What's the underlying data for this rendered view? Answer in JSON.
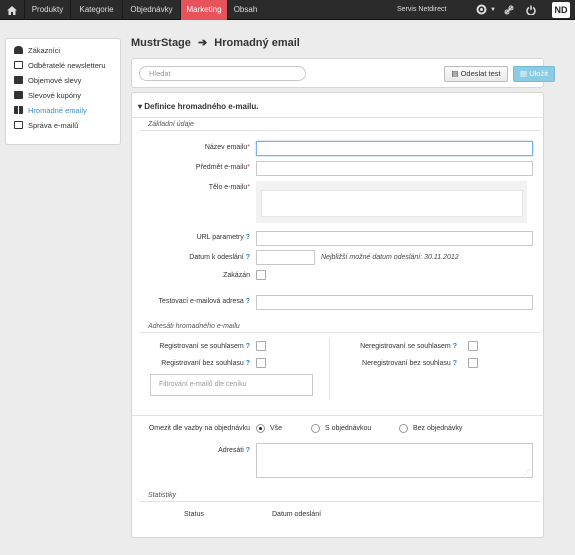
{
  "topbar": {
    "home_icon": "home-icon",
    "nav": [
      {
        "label": "Produkty"
      },
      {
        "label": "Kategorie"
      },
      {
        "label": "Objednávky"
      },
      {
        "label": "Marketing",
        "active": true
      },
      {
        "label": "Obsah"
      }
    ],
    "user": "Servis Netdirect",
    "icons": [
      "gear-icon",
      "link-icon",
      "power-icon"
    ],
    "logo": "ND"
  },
  "sidebar": {
    "items": [
      {
        "label": "Zákazníci",
        "icon": "user-icon"
      },
      {
        "label": "Odběratelé newsletteru",
        "icon": "envelope-icon"
      },
      {
        "label": "Objemové slevy",
        "icon": "folder-icon"
      },
      {
        "label": "Slevové kupóny",
        "icon": "folder-icon"
      },
      {
        "label": "Hromadné emaily",
        "icon": "grid-icon",
        "active": true
      },
      {
        "label": "Správa e-mailů",
        "icon": "envelope-icon"
      }
    ]
  },
  "page": {
    "breadcrumb_root": "MustrStage",
    "arrow": "➔",
    "title": "Hromadný email"
  },
  "toolbar": {
    "search_placeholder": "Hledat",
    "test_label": "Odeslat test",
    "save_label": "Uložit"
  },
  "form": {
    "heading": "Definice hromadného e-mailu.",
    "basic_legend": "Základní údaje",
    "name_label": "Název emailu",
    "subject_label": "Předmět e-mailu",
    "body_label": "Tělo e-mailu",
    "url_label": "URL parametry",
    "date_label": "Datum k odeslání",
    "date_note": "Nejbližší možné datum odeslání: 30.11.2012",
    "disabled_label": "Zakázán",
    "test_addr_label": "Testovací e-mailová adresa",
    "recipients_legend": "Adresáti hromadného e-mailu",
    "reg_consent_label": "Registrovaní se souhlasem",
    "reg_noconsent_label": "Registrovaní bez souhlasu",
    "unreg_consent_label": "Neregistrovaní se souhlasem",
    "unreg_noconsent_label": "Neregistrovaní bez souhlasu",
    "pricelist_placeholder": "Filtrování e-mailů dle ceníku",
    "order_filter_label": "Omezit dle vazby na objednávku",
    "opt_all": "Vše",
    "opt_with": "S objednávkou",
    "opt_without": "Bez objednávky",
    "recipients_label": "Adresáti",
    "stats_legend": "Statistiky",
    "status_col": "Status",
    "date_col": "Datum odeslání",
    "help_mark": "?",
    "req_mark": "*"
  }
}
